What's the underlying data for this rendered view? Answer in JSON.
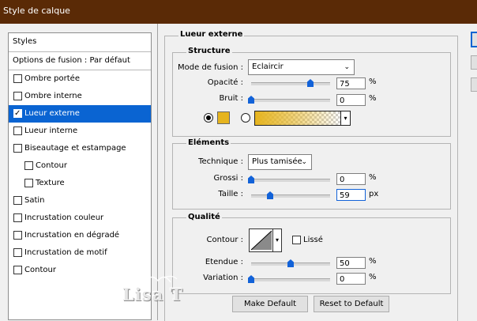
{
  "window": {
    "title": "Style de calque"
  },
  "styles_panel": {
    "header": "Styles",
    "fusion_options": "Options de fusion : Par défaut",
    "items": [
      {
        "label": "Ombre portée",
        "checked": false
      },
      {
        "label": "Ombre interne",
        "checked": false
      },
      {
        "label": "Lueur externe",
        "checked": true
      },
      {
        "label": "Lueur interne",
        "checked": false
      },
      {
        "label": "Biseautage et estampage",
        "checked": false
      },
      {
        "label": "Contour",
        "checked": false
      },
      {
        "label": "Texture",
        "checked": false
      },
      {
        "label": "Satin",
        "checked": false
      },
      {
        "label": "Incrustation couleur",
        "checked": false
      },
      {
        "label": "Incrustation en dégradé",
        "checked": false
      },
      {
        "label": "Incrustation de motif",
        "checked": false
      },
      {
        "label": "Contour",
        "checked": false
      }
    ]
  },
  "panel": {
    "title": "Lueur externe",
    "structure": {
      "title": "Structure",
      "blend_mode_label": "Mode de fusion :",
      "blend_mode_value": "Eclaircir",
      "opacity_label": "Opacité :",
      "opacity_value": "75",
      "opacity_level": 75,
      "noise_label": "Bruit :",
      "noise_value": "0",
      "noise_level": 0,
      "unit_percent": "%",
      "color_swatch": "#e6b41e",
      "gradient_from": "#e6b41e"
    },
    "elements": {
      "title": "Eléments",
      "technique_label": "Technique :",
      "technique_value": "Plus tamisée",
      "spread_label": "Grossi :",
      "spread_value": "0",
      "spread_level": 0,
      "size_label": "Taille :",
      "size_value": "59",
      "size_level": 24,
      "unit_percent": "%",
      "unit_px": "px"
    },
    "quality": {
      "title": "Qualité",
      "contour_label": "Contour :",
      "antialias_label": "Lissé",
      "range_label": "Etendue :",
      "range_value": "50",
      "range_level": 50,
      "jitter_label": "Variation :",
      "jitter_value": "0",
      "jitter_level": 0,
      "unit_percent": "%"
    },
    "buttons": {
      "make_default": "Make Default",
      "reset_default": "Reset to Default"
    }
  },
  "watermark": {
    "text": "Lisa T"
  },
  "colors": {
    "titlebar": "#5a2a06",
    "selection": "#0a64d2",
    "slider_thumb": "#1262d8"
  }
}
